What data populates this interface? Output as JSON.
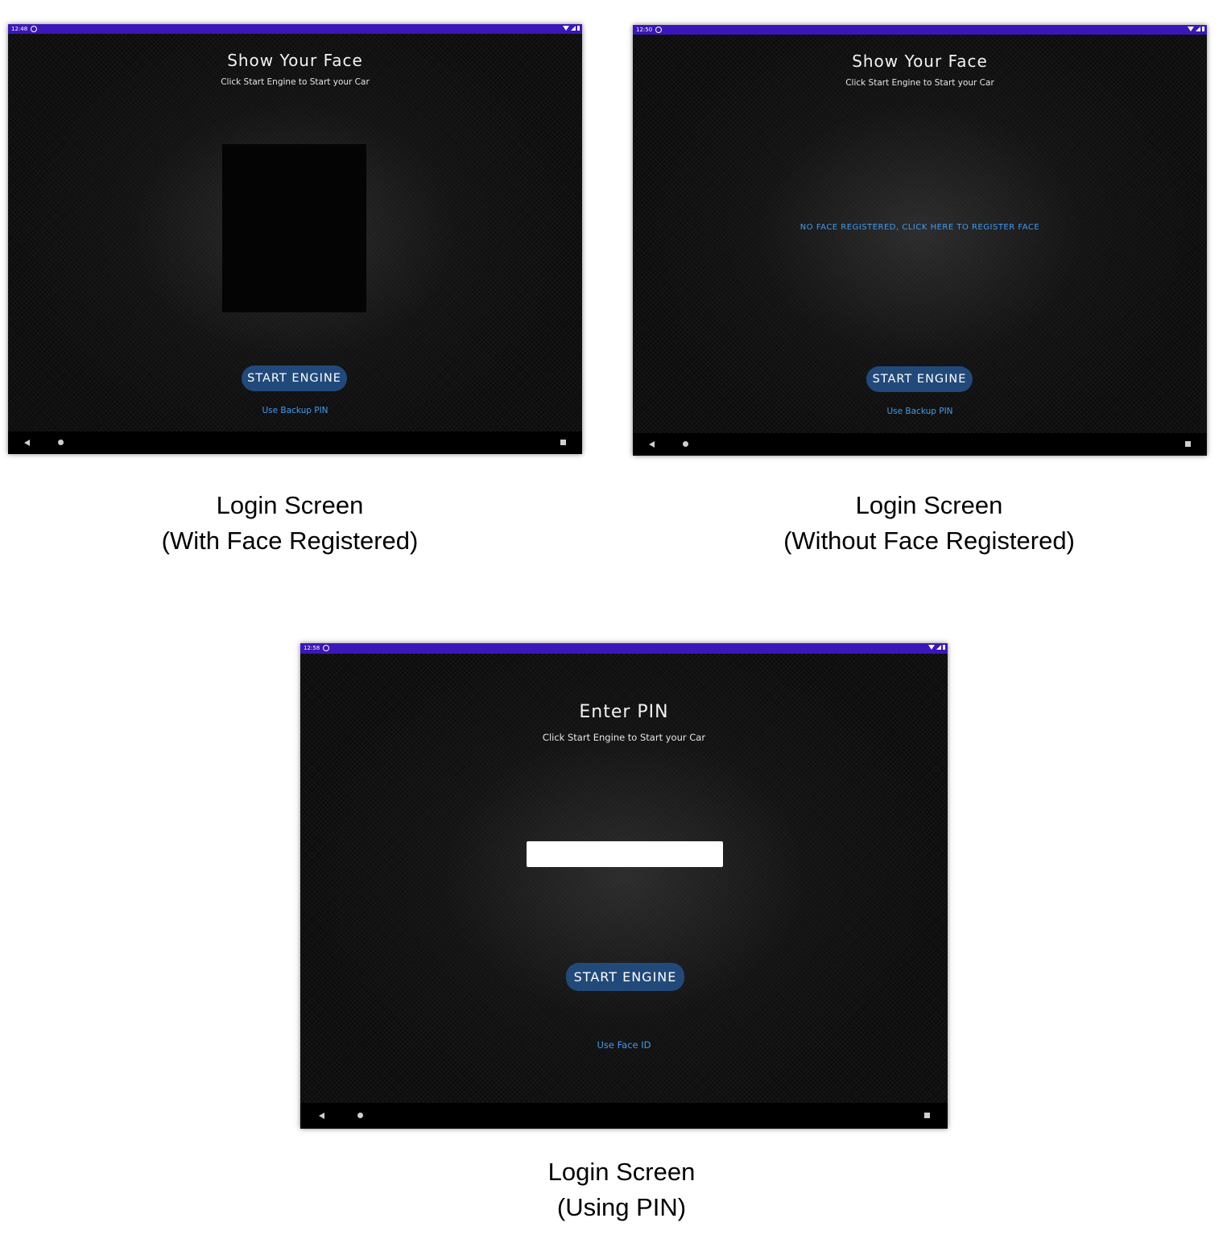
{
  "screens": [
    {
      "status_time": "12:48",
      "title": "Show Your Face",
      "subtitle": "Click Start Engine to Start your Car",
      "start_button": "START ENGINE",
      "link": "Use Backup PIN",
      "caption_line1": "Login Screen",
      "caption_line2": "(With Face Registered)"
    },
    {
      "status_time": "12:50",
      "title": "Show Your Face",
      "subtitle": "Click Start Engine to Start your Car",
      "register_link": "NO FACE REGISTERED, CLICK HERE TO REGISTER FACE",
      "start_button": "START ENGINE",
      "link": "Use Backup PIN",
      "caption_line1": "Login Screen",
      "caption_line2": "(Without Face Registered)"
    },
    {
      "status_time": "12:58",
      "title": "Enter PIN",
      "subtitle": "Click Start Engine to Start your Car",
      "pin_value": "",
      "start_button": "START ENGINE",
      "link": "Use Face ID",
      "caption_line1": "Login Screen",
      "caption_line2": "(Using PIN)"
    }
  ],
  "icons": {
    "status_left": "app-notification-icon",
    "status_right": [
      "wifi-icon",
      "signal-icon",
      "battery-icon"
    ],
    "nav": [
      "back-icon",
      "home-icon",
      "recents-icon"
    ]
  },
  "colors": {
    "status_bar": "#3a17b8",
    "button": "#214a7a",
    "link": "#3f9bf0",
    "background": "#0c0c0c"
  }
}
